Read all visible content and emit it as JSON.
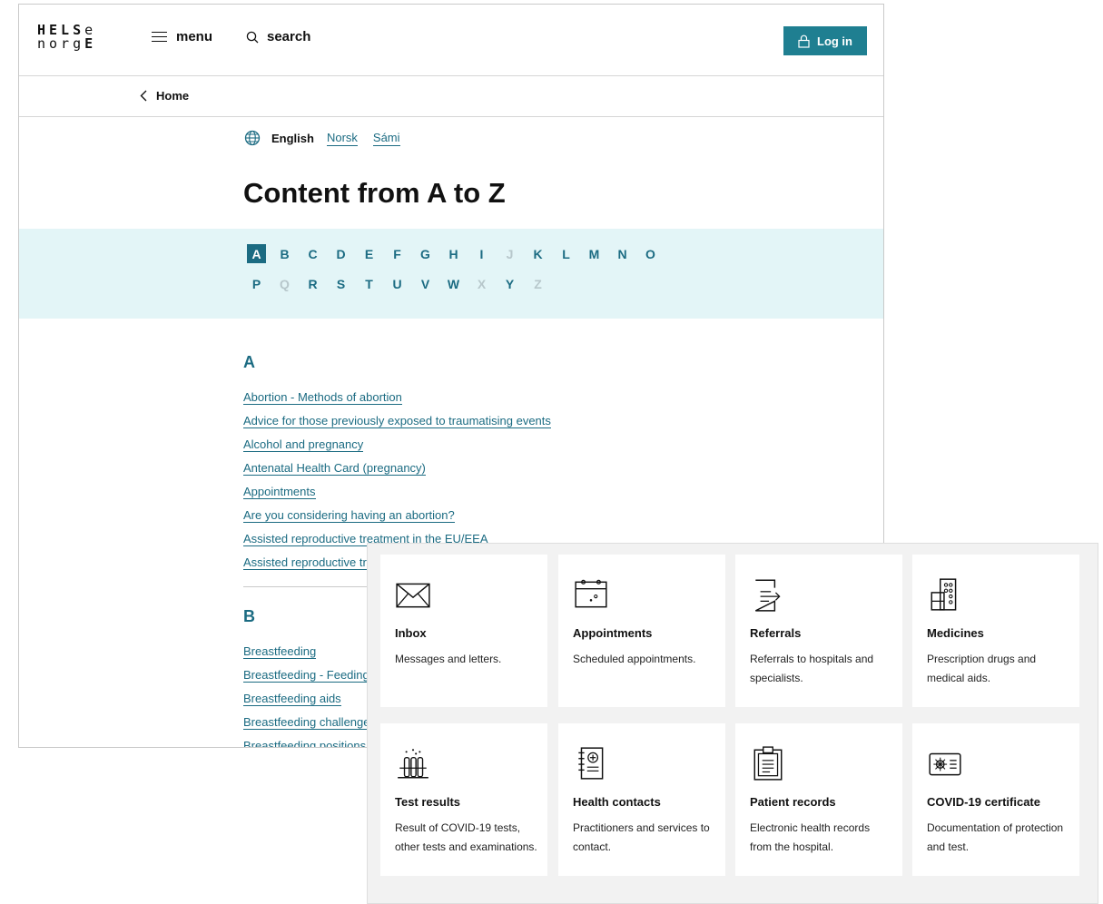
{
  "header": {
    "logo": {
      "line1_regular": "HELS",
      "line1_light": "e",
      "line2_regular": "norg",
      "line2_bold": "E"
    },
    "menu_label": "menu",
    "search_label": "search",
    "login_label": "Log in"
  },
  "breadcrumb": {
    "label": "Home"
  },
  "languages": {
    "current": "English",
    "options": [
      "Norsk",
      "Sámi"
    ]
  },
  "page_title": "Content from A to Z",
  "alphabet": {
    "row1": [
      "A",
      "B",
      "C",
      "D",
      "E",
      "F",
      "G",
      "H",
      "I",
      "J",
      "K",
      "L",
      "M",
      "N",
      "O"
    ],
    "row2": [
      "P",
      "Q",
      "R",
      "S",
      "T",
      "U",
      "V",
      "W",
      "X",
      "Y",
      "Z"
    ],
    "active": "A",
    "disabled": [
      "J",
      "Q",
      "X",
      "Z"
    ]
  },
  "sections": [
    {
      "letter": "A",
      "items": [
        "Abortion - Methods of abortion",
        "Advice for those previously exposed to traumatising events",
        "Alcohol and pregnancy",
        "Antenatal Health Card (pregnancy)",
        "Appointments",
        "Are you considering having an abortion?",
        "Assisted reproductive treatment in the EU/EEA",
        "Assisted reproductive tr"
      ]
    },
    {
      "letter": "B",
      "items": [
        "Breastfeeding",
        "Breastfeeding - Feeding",
        "Breastfeeding aids",
        "Breastfeeding challenge",
        "Breastfeeding positions"
      ]
    }
  ],
  "services": [
    {
      "icon": "envelope-icon",
      "title": "Inbox",
      "desc": "Messages and letters."
    },
    {
      "icon": "calendar-icon",
      "title": "Appointments",
      "desc": "Scheduled appointments."
    },
    {
      "icon": "referral-document-icon",
      "title": "Referrals",
      "desc": "Referrals to hospitals and specialists."
    },
    {
      "icon": "pill-pack-icon",
      "title": "Medicines",
      "desc": "Prescription drugs and medical aids."
    },
    {
      "icon": "test-tubes-icon",
      "title": "Test results",
      "desc": "Result of COVID-19 tests, other tests and examinations."
    },
    {
      "icon": "contact-book-icon",
      "title": "Health contacts",
      "desc": "Practitioners and services to contact."
    },
    {
      "icon": "clipboard-icon",
      "title": "Patient records",
      "desc": "Electronic health records from the hospital."
    },
    {
      "icon": "certificate-icon",
      "title": "COVID-19 certificate",
      "desc": "Documentation of protection and test."
    }
  ],
  "colors": {
    "brand": "#1b6b82",
    "button": "#1f7f91",
    "alpha_band": "#e3f5f7",
    "panel": "#f2f2f2"
  }
}
